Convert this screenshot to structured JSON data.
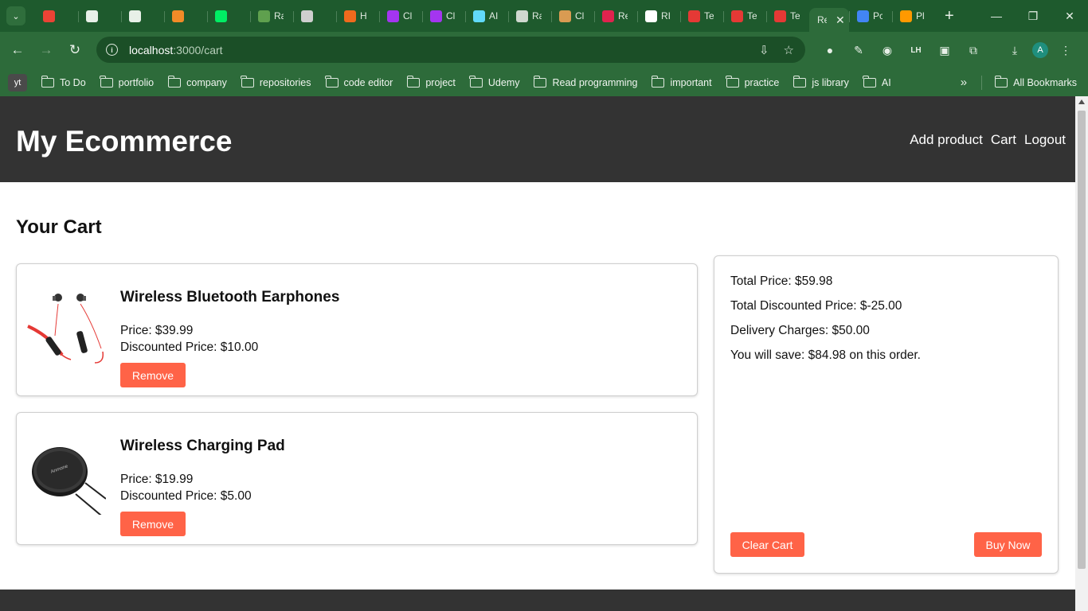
{
  "browser": {
    "tabs": [
      {
        "title": "",
        "icon": "gmail-icon",
        "color": "#ea4335"
      },
      {
        "title": "",
        "icon": "chatgpt-icon",
        "color": "#e8f0e8"
      },
      {
        "title": "",
        "icon": "github-icon",
        "color": "#e8f0e8"
      },
      {
        "title": "",
        "icon": "box-icon",
        "color": "#f28b27"
      },
      {
        "title": "",
        "icon": "mongodb-icon",
        "color": "#00ed64"
      },
      {
        "title": "Ra",
        "icon": "node-icon",
        "color": "#5fa04e"
      },
      {
        "title": "",
        "icon": "yt-icon",
        "color": "#cfcfcf"
      },
      {
        "title": "H",
        "icon": "chat-icon",
        "color": "#f06a1d"
      },
      {
        "title": "Cl",
        "icon": "udemy-icon",
        "color": "#a435f0"
      },
      {
        "title": "Cl",
        "icon": "udemy-icon",
        "color": "#a435f0"
      },
      {
        "title": "AI",
        "icon": "react-icon",
        "color": "#61dafb"
      },
      {
        "title": "Ra",
        "icon": "globe-icon",
        "color": "#cfd8cf"
      },
      {
        "title": "Cl",
        "icon": "fox-icon",
        "color": "#d99b52"
      },
      {
        "title": "Re",
        "icon": "react-icon",
        "color": "#e0234e"
      },
      {
        "title": "RI",
        "icon": "docs-icon",
        "color": "#ffffff"
      },
      {
        "title": "Te",
        "icon": "triangle-icon",
        "color": "#e53935"
      },
      {
        "title": "Te",
        "icon": "triangle-icon",
        "color": "#e53935"
      },
      {
        "title": "Te",
        "icon": "triangle-icon",
        "color": "#e53935"
      }
    ],
    "active_tab": {
      "title": "Re"
    },
    "after_tabs": [
      {
        "title": "Pc",
        "icon": "google-icon",
        "color": "#4285f4"
      },
      {
        "title": "Pl",
        "icon": "amazon-icon",
        "color": "#ff9900"
      }
    ],
    "url_host": "localhost",
    "url_path": ":3000/cart",
    "bookmarks": [
      "To Do",
      "portfolio",
      "company",
      "repositories",
      "code editor",
      "project",
      "Udemy",
      "Read programming",
      "important",
      "practice",
      "js library",
      "AI"
    ],
    "bookmark_yt": "yt",
    "all_bookmarks": "All Bookmarks",
    "profile_initial": "A"
  },
  "site": {
    "brand": "My Ecommerce",
    "nav": {
      "add_product": "Add product",
      "cart": "Cart",
      "logout": "Logout"
    },
    "cart_title": "Your Cart",
    "items": [
      {
        "name": "Wireless Bluetooth Earphones",
        "price": "Price: $39.99",
        "discounted": "Discounted Price: $10.00",
        "remove": "Remove"
      },
      {
        "name": "Wireless Charging Pad",
        "price": "Price: $19.99",
        "discounted": "Discounted Price: $5.00",
        "remove": "Remove"
      }
    ],
    "summary": {
      "total": "Total Price: $59.98",
      "total_discounted": "Total Discounted Price: $-25.00",
      "delivery": "Delivery Charges: $50.00",
      "save": "You will save: $84.98 on this order.",
      "clear": "Clear Cart",
      "buy": "Buy Now"
    },
    "colors": {
      "header": "#333333",
      "button": "#ff6347"
    }
  }
}
